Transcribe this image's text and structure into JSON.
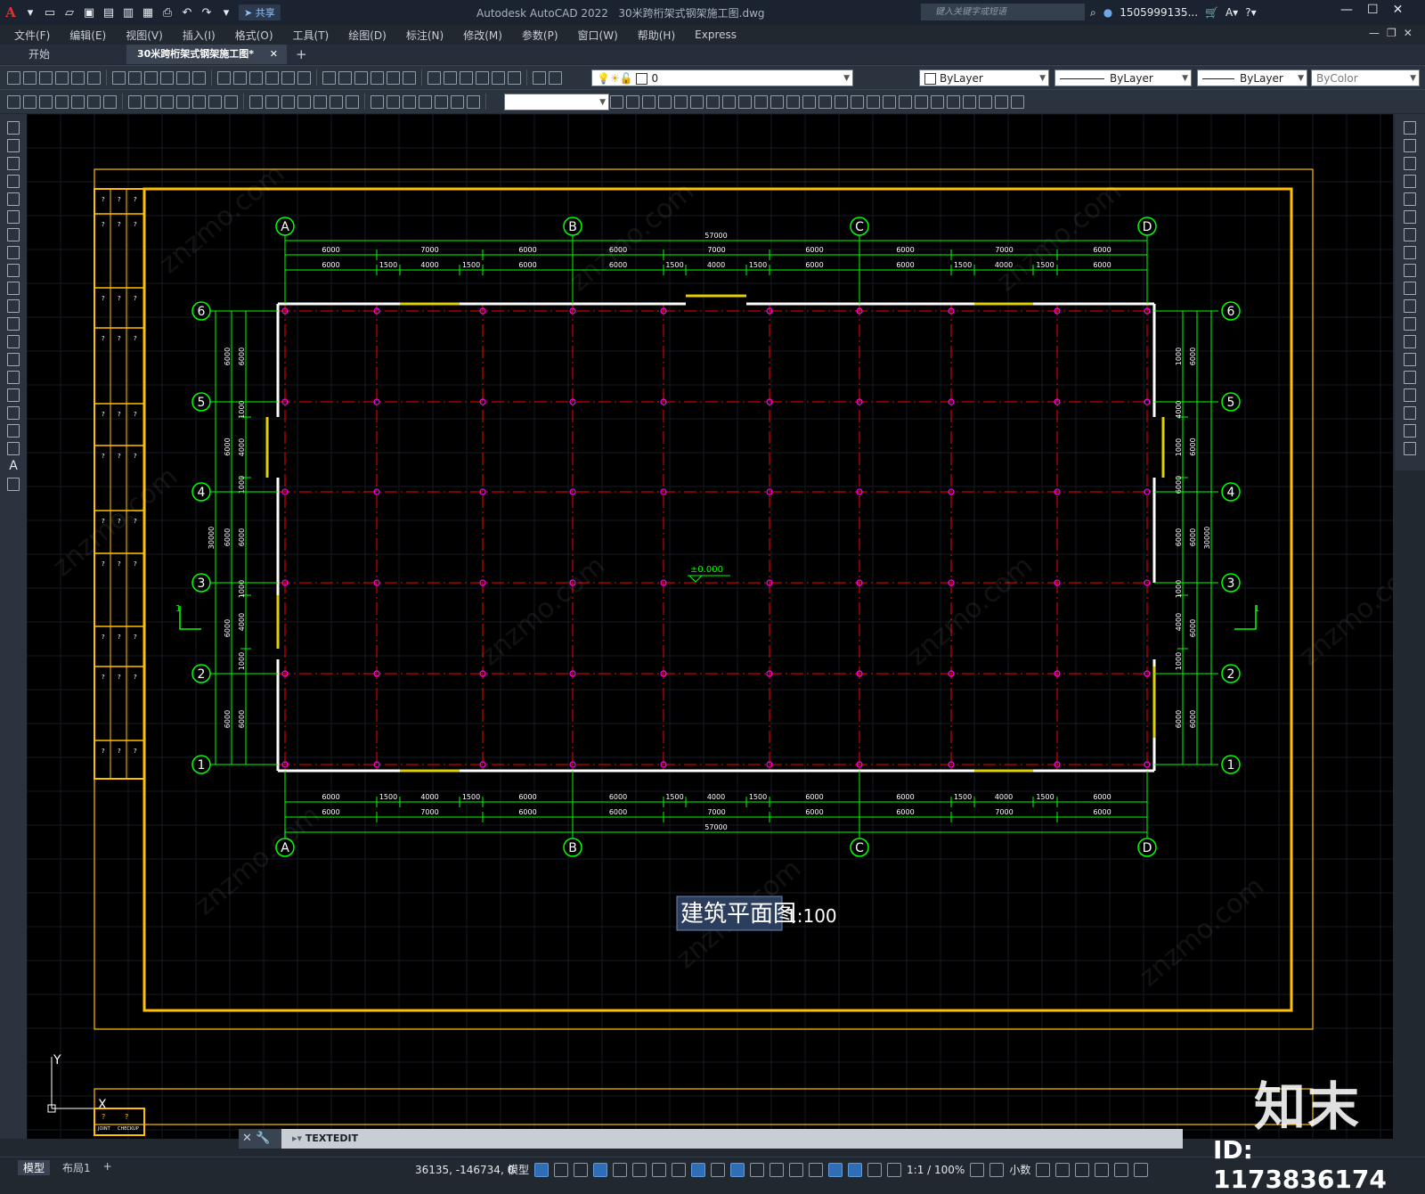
{
  "app": {
    "title": "Autodesk AutoCAD 2022",
    "document": "30米跨桁架式钢架施工图.dwg",
    "share_label": "共享",
    "search_placeholder": "键入关键字或短语",
    "username": "1505999135...",
    "menus": [
      "文件(F)",
      "编辑(E)",
      "视图(V)",
      "插入(I)",
      "格式(O)",
      "工具(T)",
      "绘图(D)",
      "标注(N)",
      "修改(M)",
      "参数(P)",
      "窗口(W)",
      "帮助(H)",
      "Express"
    ],
    "tabs": {
      "start": "开始",
      "doc": "30米跨桁架式钢架施工图*"
    }
  },
  "properties": {
    "layer": "0",
    "color": "ByLayer",
    "linetype": "ByLayer",
    "lineweight": "ByLayer",
    "plotstyle": "ByColor"
  },
  "drawing": {
    "title": "建筑平面图",
    "scale": "1:100",
    "elevation": "±0.000",
    "section_mark": "1",
    "col_axes": [
      "A",
      "B",
      "C",
      "D"
    ],
    "row_axes": [
      "6",
      "5",
      "4",
      "3",
      "2",
      "1"
    ],
    "top_total": "57000",
    "top_row1": [
      "6000",
      "7000",
      "6000",
      "6000",
      "7000",
      "6000",
      "6000",
      "7000",
      "6000"
    ],
    "top_row2": [
      "6000",
      "1500",
      "4000",
      "1500",
      "6000",
      "6000",
      "1500",
      "4000",
      "1500",
      "6000",
      "6000",
      "1500",
      "4000",
      "1500",
      "6000"
    ],
    "bottom_row1": [
      "6000",
      "1500",
      "4000",
      "1500",
      "6000",
      "6000",
      "1500",
      "4000",
      "1500",
      "6000",
      "6000",
      "1500",
      "4000",
      "1500",
      "6000"
    ],
    "bottom_row2": [
      "6000",
      "7000",
      "6000",
      "6000",
      "7000",
      "6000",
      "6000",
      "7000",
      "6000"
    ],
    "bottom_total": "57000",
    "side_total": "30000",
    "side_bay": "6000",
    "side_window": "4000",
    "side_pier": "1000",
    "titleblock_labels": [
      "JOINT",
      "CHECKUP"
    ],
    "titleblock_q": "?"
  },
  "ucs": {
    "y": "Y",
    "x": "X"
  },
  "command": {
    "text": "TEXTEDIT"
  },
  "status": {
    "tabs": [
      "模型",
      "布局1"
    ],
    "coords": "36135, -146734, 0",
    "model": "模型",
    "annoscale": "1:1 / 100%",
    "units": "小数"
  },
  "watermark": {
    "logo": "知末",
    "id": "ID: 1173836174",
    "site": "znzmo.com"
  },
  "colors": {
    "grid_yellow": "#ffc000",
    "dim_green": "#00ff00",
    "axis_red": "#ff0000",
    "node_magenta": "#ff00ff"
  }
}
